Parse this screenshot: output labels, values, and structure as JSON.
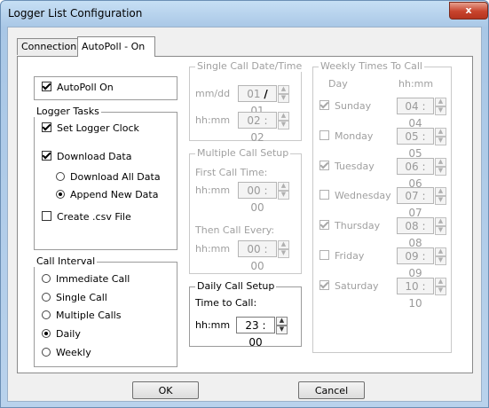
{
  "window": {
    "title": "Logger List Configuration",
    "close_label": "x"
  },
  "tabs": [
    {
      "label": "Connection"
    },
    {
      "label": "AutoPoll - On"
    }
  ],
  "autopoll": {
    "label": "AutoPoll On",
    "checked": true
  },
  "logger_tasks": {
    "legend": "Logger Tasks",
    "set_clock": "Set Logger Clock",
    "download_data": "Download Data",
    "download_all": "Download All Data",
    "append_new": "Append New Data",
    "create_csv": "Create .csv File"
  },
  "call_interval": {
    "legend": "Call Interval",
    "options": [
      "Immediate Call",
      "Single Call",
      "Multiple Calls",
      "Daily",
      "Weekly"
    ],
    "selected": "Daily"
  },
  "single_call": {
    "legend": "Single Call Date/Time",
    "date_label": "mm/dd",
    "month": "01",
    "date_sep": "/",
    "day": "01",
    "time_label": "hh:mm",
    "hour": "02",
    "time_sep": ":",
    "minute": "02"
  },
  "multiple_call": {
    "legend": "Multiple Call Setup",
    "first_label": "First Call Time:",
    "first_hhmm": "hh:mm",
    "first_hour": "00",
    "first_minute": "00",
    "every_label": "Then Call Every:",
    "every_hhmm": "hh:mm",
    "every_hour": "00",
    "every_minute": "00"
  },
  "daily_call": {
    "legend": "Daily Call Setup",
    "time_label": "Time to Call:",
    "hhmm": "hh:mm",
    "hour": "23",
    "minute": "00"
  },
  "weekly": {
    "legend": "Weekly Times To Call",
    "col_day": "Day",
    "col_time": "hh:mm",
    "days": [
      {
        "name": "Sunday",
        "checked": true,
        "hour": "04",
        "minute": "04"
      },
      {
        "name": "Monday",
        "checked": false,
        "hour": "05",
        "minute": "05"
      },
      {
        "name": "Tuesday",
        "checked": true,
        "hour": "06",
        "minute": "06"
      },
      {
        "name": "Wednesday",
        "checked": false,
        "hour": "07",
        "minute": "07"
      },
      {
        "name": "Thursday",
        "checked": true,
        "hour": "08",
        "minute": "08"
      },
      {
        "name": "Friday",
        "checked": false,
        "hour": "09",
        "minute": "09"
      },
      {
        "name": "Saturday",
        "checked": true,
        "hour": "10",
        "minute": "10"
      }
    ]
  },
  "buttons": {
    "ok": "OK",
    "cancel": "Cancel"
  },
  "colors": {
    "title_bar": "#b9d2ec",
    "close_button": "#c7432c",
    "dialog_bg": "#f0f0f0",
    "disabled_text": "#a0a0a0"
  }
}
